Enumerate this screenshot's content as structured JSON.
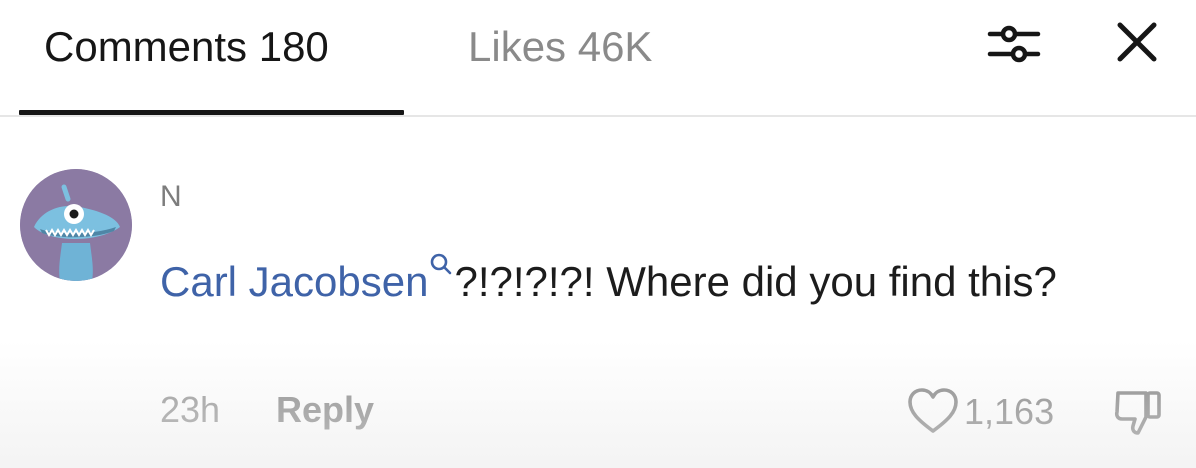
{
  "tabs": {
    "comments_label": "Comments 180",
    "likes_label": "Likes 46K"
  },
  "header": {
    "filter_icon": "sliders-icon",
    "close_icon": "close-icon"
  },
  "comment": {
    "username": "N",
    "mention": "Carl Jacobsen",
    "mention_icon": "search-icon",
    "text": "?!?!?!?! Where did you find this?",
    "time": "23h",
    "reply_label": "Reply",
    "like_count": "1,163",
    "avatar_icon": "monster-avatar"
  },
  "colors": {
    "mention": "#3f63a8",
    "avatar_bg": "#8b7aa3",
    "muted": "#8a8a8a"
  }
}
